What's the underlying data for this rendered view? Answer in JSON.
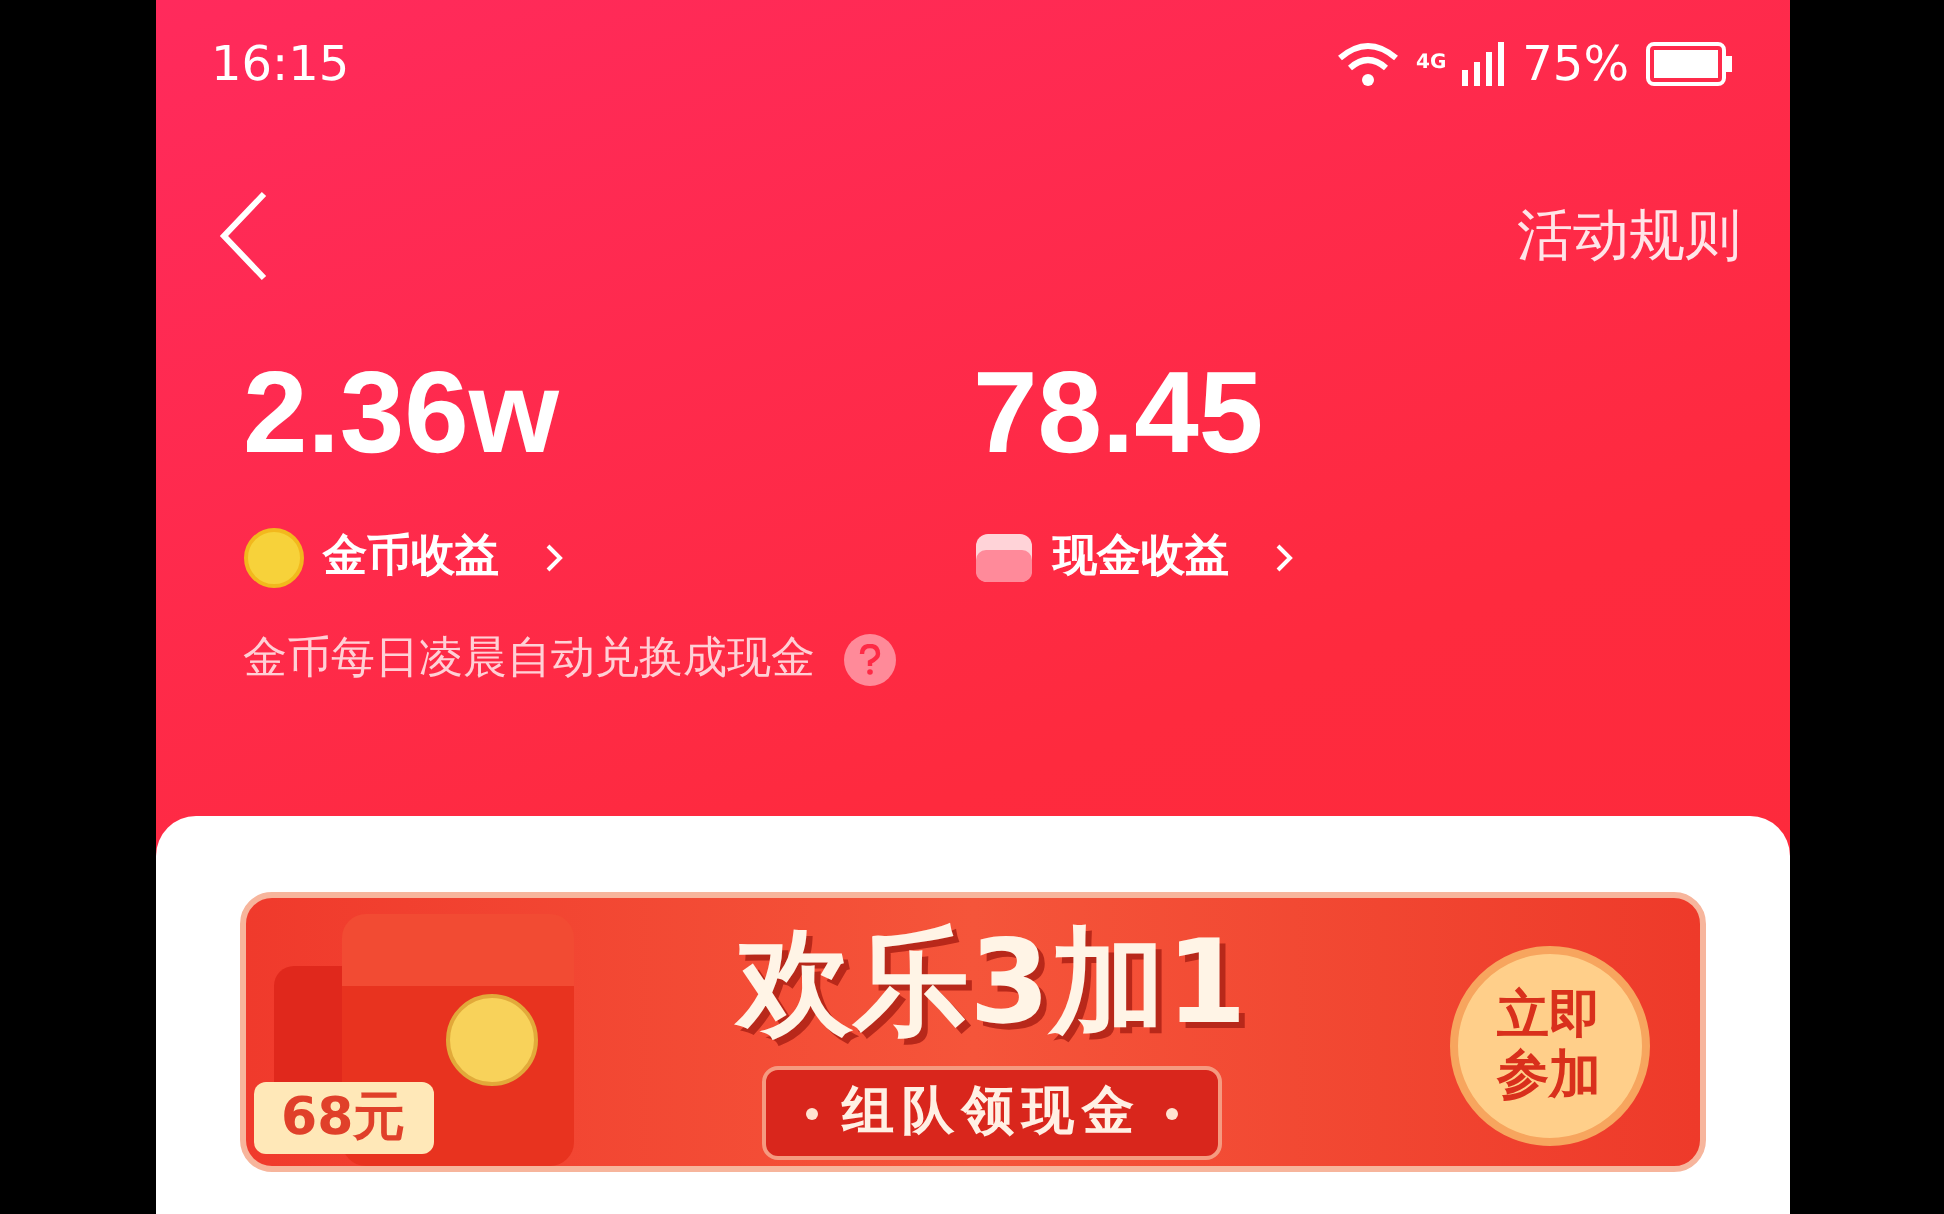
{
  "status_bar": {
    "time": "16:15",
    "network": "4G",
    "battery": "75%"
  },
  "nav": {
    "rules_link": "活动规则"
  },
  "stats": [
    {
      "kind": "coin",
      "value": "2.36w",
      "label": "金币收益"
    },
    {
      "kind": "cash",
      "value": "78.45",
      "label": "现金收益"
    }
  ],
  "note": "金币每日凌晨自动兑换成现金",
  "banner": {
    "tag": "68元",
    "title": "欢乐3加1",
    "subtitle": "组队领现金",
    "button": "立即参加"
  }
}
